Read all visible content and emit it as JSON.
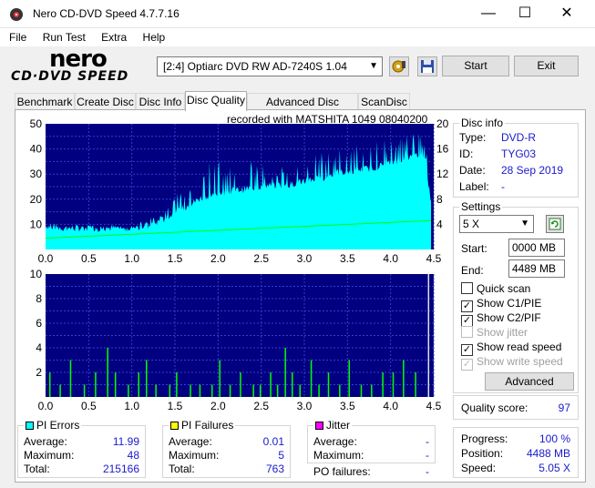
{
  "window": {
    "title": "Nero CD-DVD Speed 4.7.7.16",
    "minimize": "—",
    "maximize": "☐",
    "close": "✕"
  },
  "menu": [
    "File",
    "Run Test",
    "Extra",
    "Help"
  ],
  "logo": {
    "line1": "nero",
    "line2": "CD·DVD SPEED"
  },
  "toolbar": {
    "drive": "[2:4]  Optiarc DVD RW AD-7240S 1.04",
    "start_label": "Start",
    "exit_label": "Exit"
  },
  "tabs": [
    "Benchmark",
    "Create Disc",
    "Disc Info",
    "Disc Quality",
    "Advanced Disc Quality",
    "ScanDisc"
  ],
  "active_tab": "Disc Quality",
  "recorded_with": "recorded with MATSHITA 1049 08040200",
  "disc_info": {
    "title": "Disc info",
    "type_label": "Type:",
    "type_value": "DVD-R",
    "id_label": "ID:",
    "id_value": "TYG03",
    "date_label": "Date:",
    "date_value": "28 Sep 2019",
    "label_label": "Label:",
    "label_value": "-"
  },
  "settings": {
    "title": "Settings",
    "speed": "5 X",
    "start_label": "Start:",
    "start_value": "0000 MB",
    "end_label": "End:",
    "end_value": "4489 MB",
    "checks": [
      {
        "label": "Quick scan",
        "checked": false,
        "disabled": false
      },
      {
        "label": "Show C1/PIE",
        "checked": true,
        "disabled": false
      },
      {
        "label": "Show C2/PIF",
        "checked": true,
        "disabled": false
      },
      {
        "label": "Show jitter",
        "checked": false,
        "disabled": true
      },
      {
        "label": "Show read speed",
        "checked": true,
        "disabled": false
      },
      {
        "label": "Show write speed",
        "checked": true,
        "disabled": true
      }
    ],
    "advanced_label": "Advanced"
  },
  "quality": {
    "label": "Quality score:",
    "value": "97"
  },
  "progress": {
    "progress_label": "Progress:",
    "progress_value": "100 %",
    "position_label": "Position:",
    "position_value": "4488 MB",
    "speed_label": "Speed:",
    "speed_value": "5.05 X"
  },
  "pi_errors": {
    "title": "PI Errors",
    "color": "#00ffff",
    "average_label": "Average:",
    "average": "11.99",
    "maximum_label": "Maximum:",
    "maximum": "48",
    "total_label": "Total:",
    "total": "215166"
  },
  "pi_failures": {
    "title": "PI Failures",
    "color": "#ffff00",
    "average_label": "Average:",
    "average": "0.01",
    "maximum_label": "Maximum:",
    "maximum": "5",
    "total_label": "Total:",
    "total": "763"
  },
  "jitter": {
    "title": "Jitter",
    "color": "#ff00ff",
    "average_label": "Average:",
    "average": "-",
    "maximum_label": "Maximum:",
    "maximum": "-"
  },
  "po_failures": {
    "label": "PO failures:",
    "value": "-"
  },
  "colors": {
    "plot_bg": "#000080",
    "grid": "#3a3ad0",
    "pie": "#00ffff",
    "pif": "#00ff00",
    "read_speed": "#00ff00"
  },
  "chart_data": [
    {
      "type": "area",
      "name": "PI Errors chart",
      "x_ticks": [
        "0.0",
        "0.5",
        "1.0",
        "1.5",
        "2.0",
        "2.5",
        "3.0",
        "3.5",
        "4.0",
        "4.5"
      ],
      "y_left_ticks": [
        "10",
        "20",
        "30",
        "40",
        "50"
      ],
      "y_right_ticks": [
        "4",
        "8",
        "12",
        "16",
        "20"
      ],
      "xlim": [
        0,
        4.5
      ],
      "ylim": [
        0,
        50
      ],
      "y2lim": [
        0,
        20
      ],
      "series": [
        {
          "name": "PIE",
          "x": [
            0.0,
            0.2,
            0.4,
            0.6,
            0.8,
            1.0,
            1.2,
            1.4,
            1.6,
            1.8,
            2.0,
            2.2,
            2.4,
            2.6,
            2.8,
            3.0,
            3.2,
            3.4,
            3.6,
            3.8,
            4.0,
            4.2,
            4.4,
            4.47
          ],
          "values": [
            8,
            7,
            7,
            7,
            7,
            7,
            8,
            11,
            15,
            19,
            21,
            22,
            23,
            24,
            24,
            26,
            27,
            29,
            30,
            31,
            33,
            35,
            36,
            16
          ]
        },
        {
          "name": "PIE peaks",
          "x": [
            0.1,
            0.5,
            0.9,
            1.3,
            1.5,
            1.7,
            1.9,
            2.1,
            2.3,
            2.5,
            2.7,
            2.9,
            3.1,
            3.3,
            3.5,
            3.7,
            3.9,
            4.1,
            4.3,
            4.4
          ],
          "values": [
            11,
            10,
            9,
            14,
            22,
            28,
            35,
            36,
            38,
            34,
            33,
            38,
            39,
            40,
            41,
            43,
            44,
            45,
            48,
            44
          ]
        },
        {
          "name": "Read speed",
          "x": [
            0.0,
            4.47
          ],
          "values": [
            1.8,
            4.6
          ]
        }
      ]
    },
    {
      "type": "bar",
      "name": "PI Failures chart",
      "x_ticks": [
        "0.0",
        "0.5",
        "1.0",
        "1.5",
        "2.0",
        "2.5",
        "3.0",
        "3.5",
        "4.0",
        "4.5"
      ],
      "y_ticks": [
        "2",
        "4",
        "6",
        "8",
        "10"
      ],
      "xlim": [
        0,
        4.5
      ],
      "ylim": [
        0,
        10
      ],
      "x": [
        0.05,
        0.17,
        0.29,
        0.45,
        0.58,
        0.72,
        0.81,
        0.96,
        1.08,
        1.17,
        1.28,
        1.44,
        1.52,
        1.68,
        1.79,
        1.93,
        2.02,
        2.14,
        2.26,
        2.41,
        2.49,
        2.61,
        2.69,
        2.78,
        2.86,
        2.95,
        3.08,
        3.17,
        3.28,
        3.41,
        3.52,
        3.66,
        3.78,
        3.91,
        4.03,
        4.15,
        4.29,
        4.44
      ],
      "values": [
        2,
        1,
        3,
        1,
        2,
        4,
        2,
        1,
        2,
        3,
        1,
        1,
        2,
        1,
        1,
        1,
        3,
        1,
        2,
        1,
        1,
        2,
        1,
        4,
        2,
        1,
        3,
        1,
        2,
        1,
        3,
        1,
        1,
        2,
        2,
        3,
        2,
        10
      ]
    }
  ]
}
